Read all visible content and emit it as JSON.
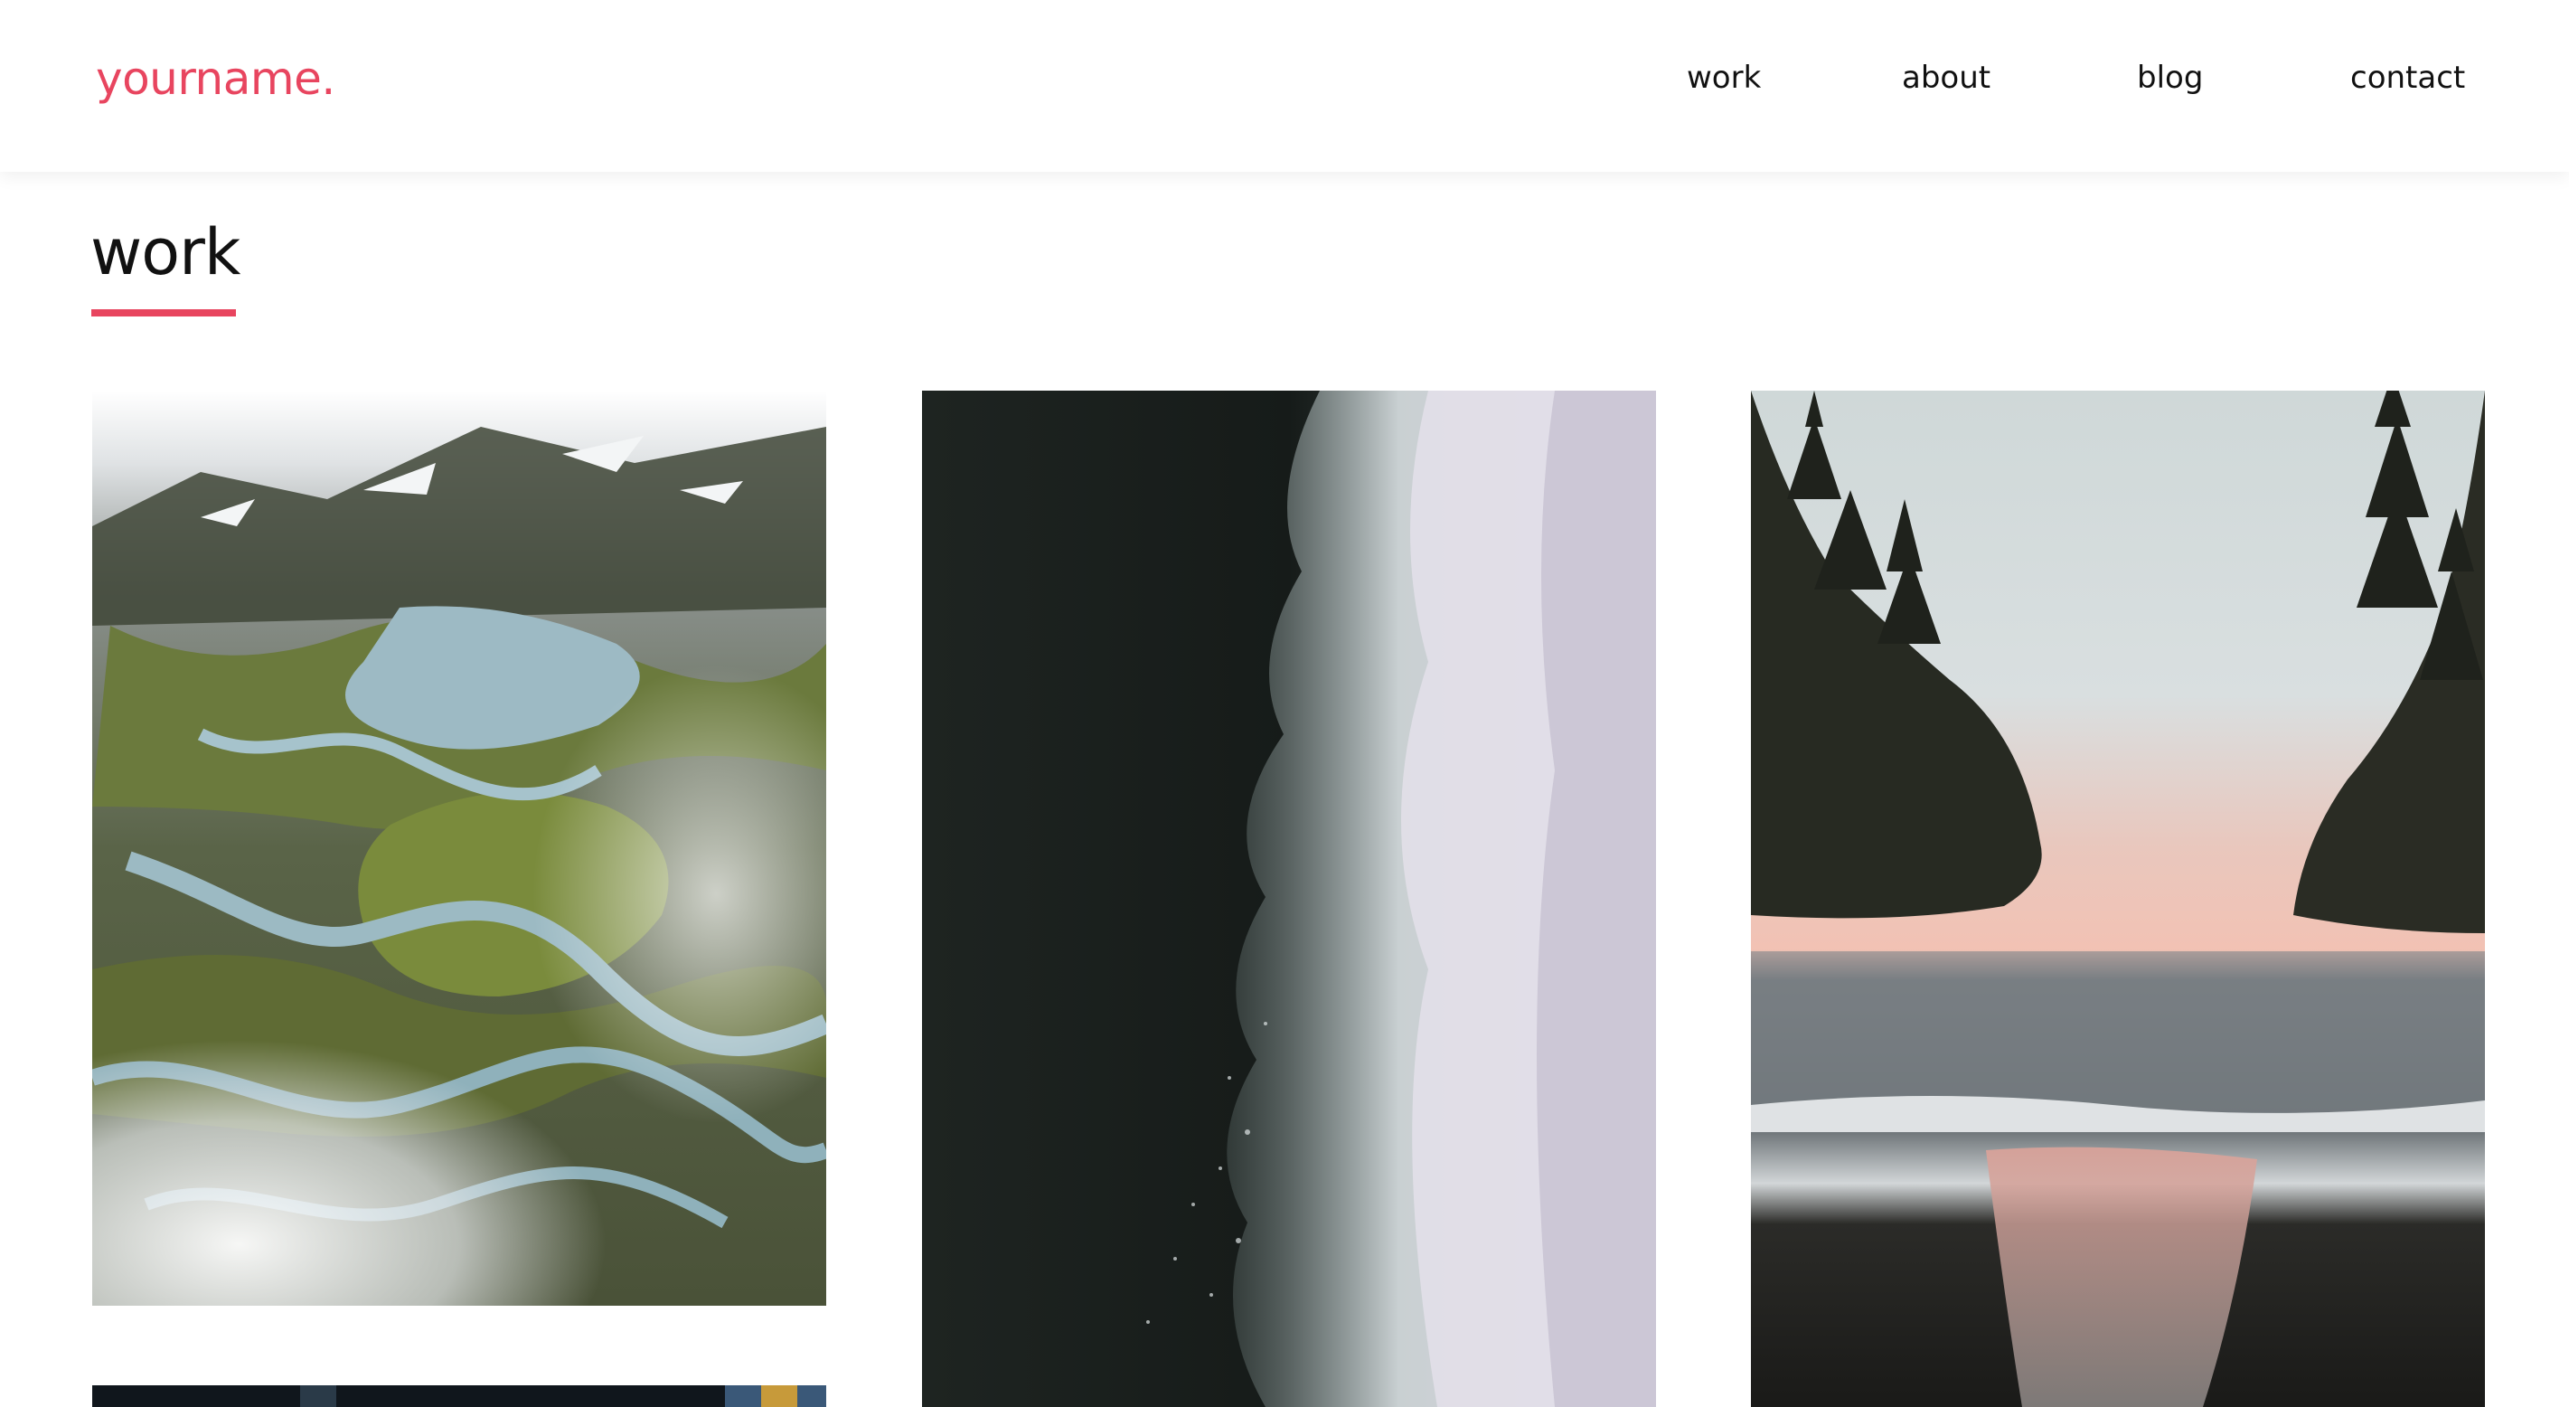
{
  "header": {
    "logo": "yourname.",
    "nav": [
      {
        "label": "work"
      },
      {
        "label": "about"
      },
      {
        "label": "blog"
      },
      {
        "label": "contact"
      }
    ]
  },
  "main": {
    "section_title": "work",
    "portfolio": [
      {
        "subject": "aerial river delta with snowy mountains"
      },
      {
        "subject": "ocean wave crashing on dark water, aerial"
      },
      {
        "subject": "sunset seen between sea cliffs with pine trees"
      },
      {
        "subject": "dark image, partially visible"
      }
    ]
  },
  "colors": {
    "accent": "#e8455f",
    "text": "#111111",
    "background": "#ffffff"
  }
}
